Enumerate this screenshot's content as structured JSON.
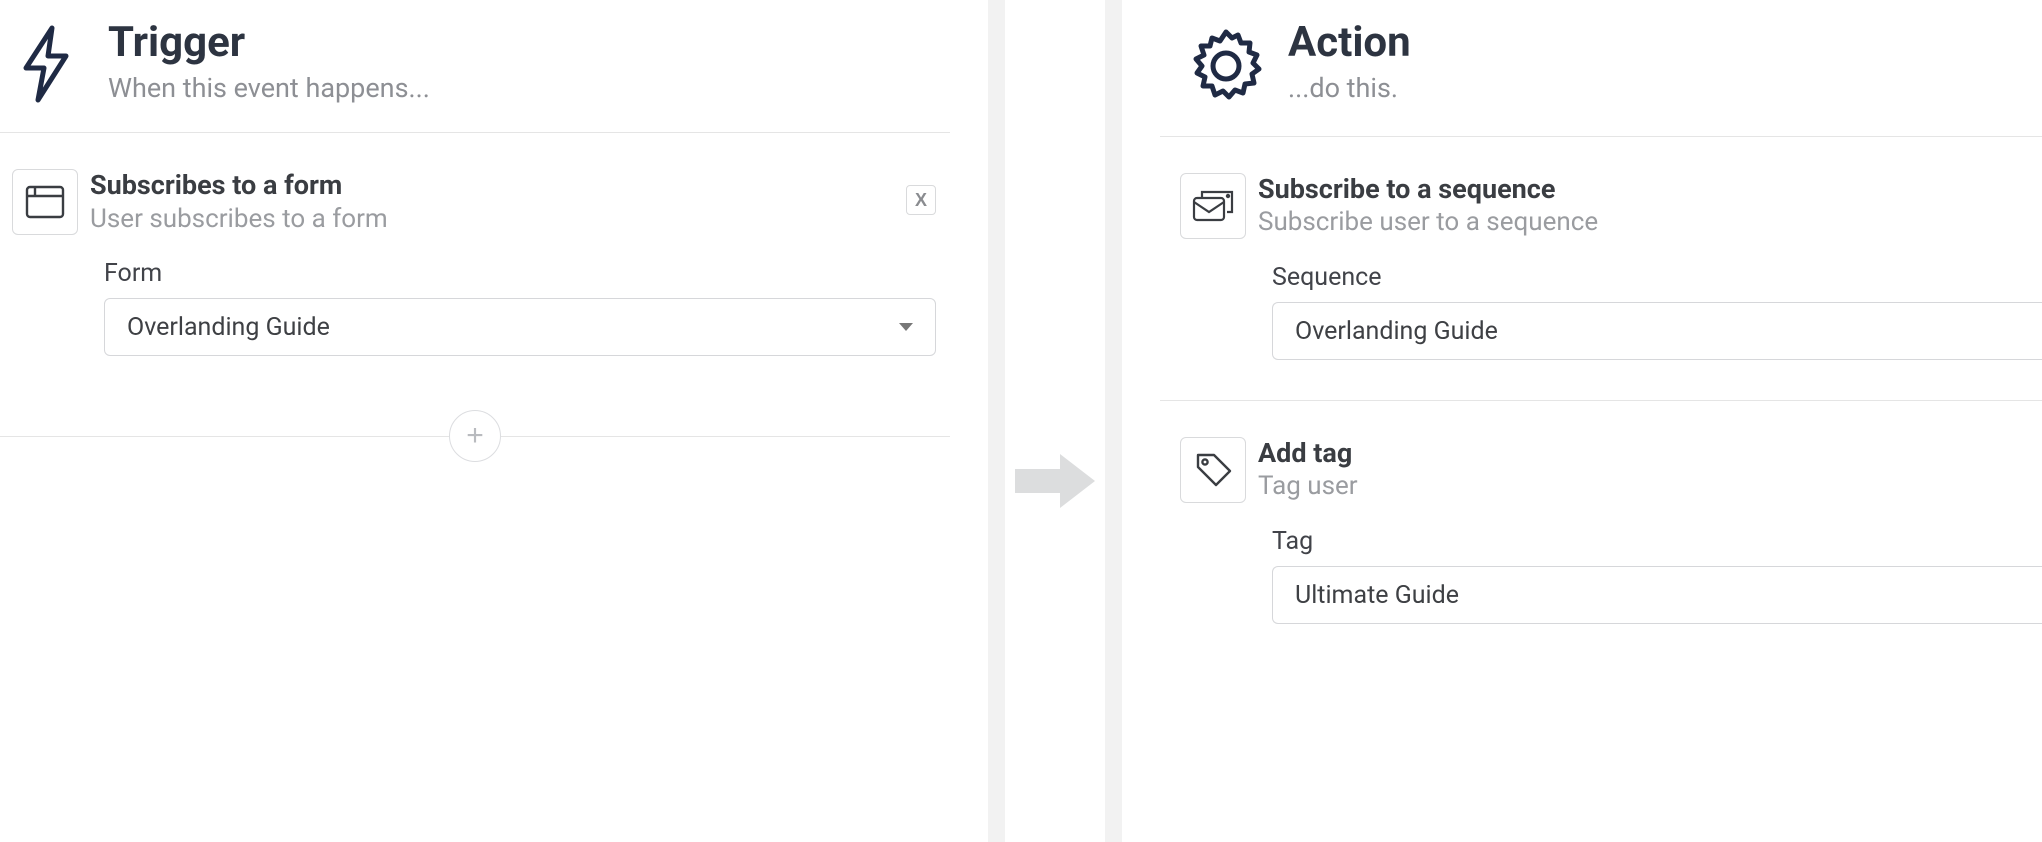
{
  "trigger": {
    "title": "Trigger",
    "subtitle": "When this event happens...",
    "rules": [
      {
        "icon": "browser-window-icon",
        "title": "Subscribes to a form",
        "desc": "User subscribes to a form",
        "close_label": "X",
        "field": {
          "label": "Form",
          "value": "Overlanding Guide"
        }
      }
    ]
  },
  "action": {
    "title": "Action",
    "subtitle": "...do this.",
    "rules": [
      {
        "icon": "envelopes-icon",
        "title": "Subscribe to a sequence",
        "desc": "Subscribe user to a sequence",
        "field": {
          "label": "Sequence",
          "value": "Overlanding Guide"
        }
      },
      {
        "icon": "tag-icon",
        "title": "Add tag",
        "desc": "Tag user",
        "field": {
          "label": "Tag",
          "value": "Ultimate Guide"
        }
      }
    ]
  },
  "add_button_label": "+"
}
